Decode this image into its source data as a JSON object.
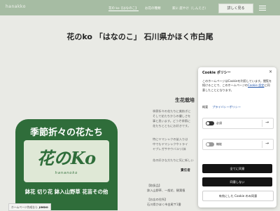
{
  "header": {
    "logo": "hanakko",
    "nav": [
      "花の ko【はなのこ】",
      "お花の種類",
      "家に 庭やけ（しんえさ）"
    ],
    "detail_button": "詳しく見る"
  },
  "page": {
    "title": "花のko 「はなのこ」 石川県かほく市白尾",
    "section_title": "生花栽培",
    "body_lines": [
      "季節折々の花たちに美紡ぎに",
      "そして花たちからの優しさを",
      "事と思います。どうぞ季節に",
      "花たちとともにお好きです。"
    ],
    "body_lines2": [
      "特にヤマシャクの苗入りは",
      "中でもヤマシャクやトライ",
      "ヤブレガサやウバユリ(体"
    ],
    "body_line3": "花の好きな方たちに気に新しい",
    "responsible": "責任者",
    "info_label": "【取扱品】",
    "info_line": "鉢入山野草、一般花、観葉植",
    "store_label": "【お店の住所】",
    "store_line": "石川県かほく市白尾サ1番"
  },
  "sign": {
    "heading": "季節折々の花たち",
    "logo": "花のKo",
    "roman": "hananoko",
    "bottom": "鉢花 切り花 鉢入山野草 花苗その他"
  },
  "footer": {
    "badge_text": "ホームページ作成なら",
    "brand": "JIMDO"
  },
  "cookie": {
    "title": "Cookie ポリシー",
    "close": "×",
    "text_before": "このホームページはCookieを利用しています。閲覧を続けることで、このホームページの",
    "link": "Cookie 設定",
    "text_after": "に同意したことになります。",
    "tab_summary": "概要",
    "tab_privacy": "プライバシーポリシー",
    "row1_label": "必須",
    "row2_label": "機能",
    "arrow": "→",
    "btn_accept": "全てに同意",
    "btn_decline": "同意しない",
    "btn_settings": "有効にした Cookie のみ同意"
  }
}
